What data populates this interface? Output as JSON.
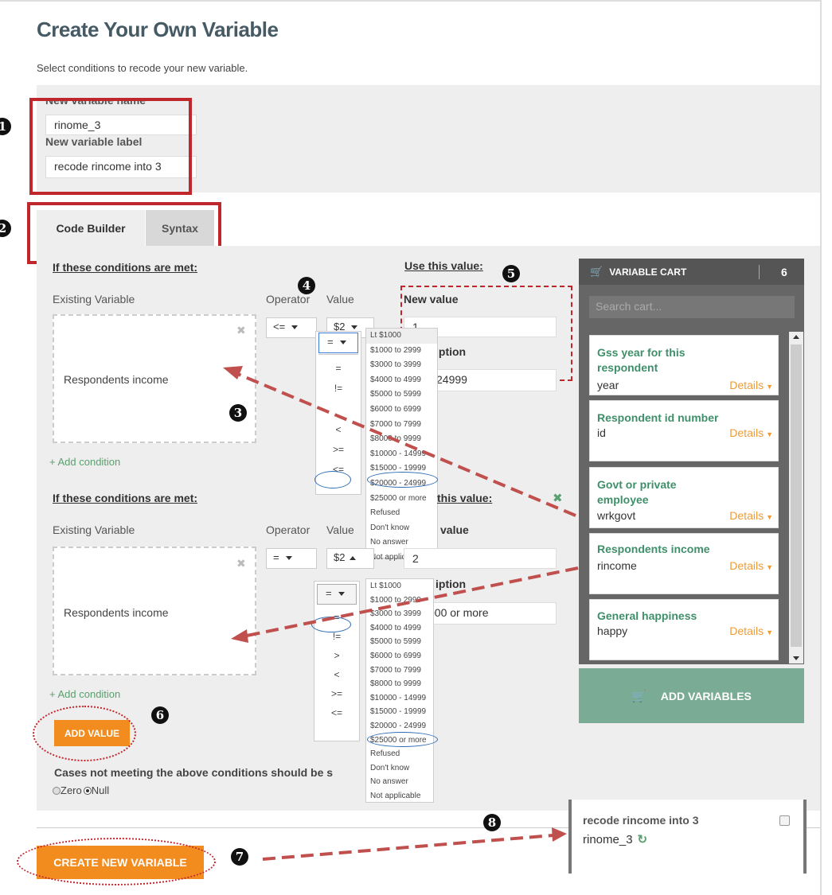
{
  "page": {
    "title": "Create Your Own Variable",
    "subtitle": "Select conditions to recode your new variable."
  },
  "new_variable": {
    "name_label": "New variable name",
    "name_value": "rinome_3",
    "label_label": "New variable label",
    "label_value": "recode rincome into 3"
  },
  "tabs": [
    "Code Builder",
    "Syntax"
  ],
  "block1": {
    "conditions_heading": "If these conditions are met:",
    "use_value_heading": "Use this value:",
    "existing_variable_label": "Existing Variable",
    "operator_label": "Operator",
    "value_label": "Value",
    "variable": "Respondents income",
    "operator": "<=",
    "value": "$2",
    "new_value_label": "New value",
    "new_value": "1",
    "description_label": "Description",
    "description_label_visible": "iption",
    "description_value_visible": "24999",
    "add_condition": "+ Add condition"
  },
  "block2": {
    "conditions_heading": "If these conditions are met:",
    "use_value_heading_visible": "this value:",
    "existing_variable_label": "Existing Variable",
    "operator_label": "Operator",
    "value_label": "Value",
    "variable": "Respondents income",
    "operator": "=",
    "value": "$2",
    "new_value_label_visible": "value",
    "new_value": "2",
    "description_label_visible": "iption",
    "description_value_visible": "000 or more",
    "add_condition": "+ Add condition"
  },
  "operator_dropdown": {
    "selected": "=",
    "options": [
      "=",
      "!=",
      ">",
      "<",
      ">=",
      "<="
    ]
  },
  "operator_dropdown_1_visible": [
    "=",
    "!=",
    "<",
    ">=",
    "<="
  ],
  "value_options": [
    "Lt $1000",
    "$1000 to 2999",
    "$3000 to 3999",
    "$4000 to 4999",
    "$5000 to 5999",
    "$6000 to 6999",
    "$7000 to 7999",
    "$8000 to 9999",
    "$10000 - 14999",
    "$15000 - 19999",
    "$20000 - 24999",
    "$25000 or more",
    "Refused",
    "Don't know",
    "No answer",
    "Not applicable"
  ],
  "add_value_button": "ADD VALUE",
  "cases_text": "Cases not meeting the above conditions should be s",
  "radio": {
    "zero": "Zero",
    "null": "Null"
  },
  "cart": {
    "title": "VARIABLE CART",
    "count": "6",
    "search_placeholder": "Search cart...",
    "items": [
      {
        "label": "Gss year for this respondent",
        "name": "year",
        "details": "Details"
      },
      {
        "label": "Respondent id number",
        "name": "id",
        "details": "Details"
      },
      {
        "label": "Govt or private employee",
        "name": "wrkgovt",
        "details": "Details"
      },
      {
        "label": "Respondents income",
        "name": "rincome",
        "details": "Details"
      },
      {
        "label": "General happiness",
        "name": "happy",
        "details": "Details"
      }
    ],
    "add_button": "ADD VARIABLES"
  },
  "create_button": "CREATE NEW VARIABLE",
  "result": {
    "label": "recode rincome into 3",
    "name": "rinome_3"
  },
  "badges": [
    "1",
    "2",
    "3",
    "4",
    "5",
    "6",
    "7",
    "8"
  ],
  "colors": {
    "accent_orange": "#f28c1e",
    "green": "#3f8f6a",
    "annotation_red": "#c0272d",
    "cart_bg": "#666666"
  }
}
